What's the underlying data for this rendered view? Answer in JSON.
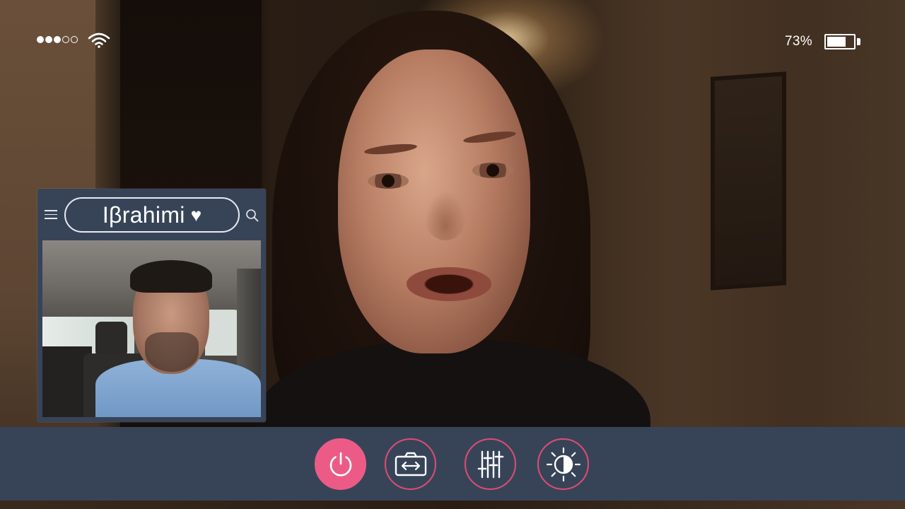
{
  "status_bar": {
    "signal_bars_total": 5,
    "signal_bars_filled": 3,
    "wifi_icon": "wifi-icon",
    "battery_percent_label": "73%",
    "battery_level": 0.73
  },
  "self_view": {
    "caller_name": "Iβrahimi",
    "menu_icon": "hamburger-menu-icon",
    "heart_icon": "heart-icon",
    "search_icon": "search-icon"
  },
  "controls": [
    {
      "name": "end-call-button",
      "icon": "power-icon"
    },
    {
      "name": "switch-camera-button",
      "icon": "switch-camera-icon"
    },
    {
      "name": "adjust-settings-button",
      "icon": "sliders-icon"
    },
    {
      "name": "brightness-button",
      "icon": "brightness-icon"
    }
  ],
  "colors": {
    "panel": "#374458",
    "accent": "#ec5b86",
    "accent_border": "#e24b74",
    "icon": "#ffffff"
  }
}
